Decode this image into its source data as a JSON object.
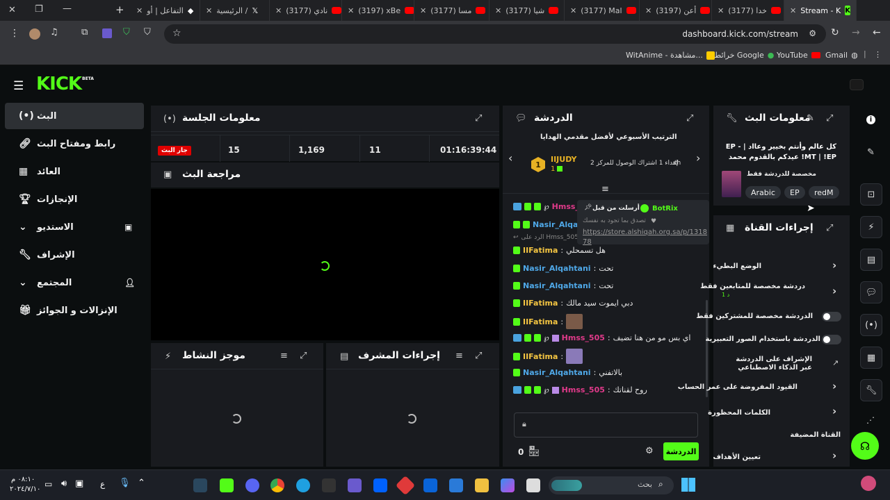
{
  "browser": {
    "tabs": [
      {
        "label": "التفاعل | أو"
      },
      {
        "label": "الرئيسية /"
      },
      {
        "label": "(3177) نادي"
      },
      {
        "label": "(3197) xBe"
      },
      {
        "label": "(3177) مسا"
      },
      {
        "label": "(3177) شيا"
      },
      {
        "label": "(3177) Mal"
      },
      {
        "label": "(3197) أعن"
      },
      {
        "label": "(3177) خدا"
      },
      {
        "label": "Stream - K"
      }
    ],
    "new_tab_label": "+",
    "url": "dashboard.kick.com/stream",
    "bookmarks": [
      "WitAnime - مشاهدة...",
      "خرائط Google",
      "YouTube",
      "Gmail"
    ]
  },
  "app": {
    "logo": "KICK",
    "logo_sup": "BETA",
    "nav": [
      {
        "label": "البث",
        "icon": "broadcast-icon"
      },
      {
        "label": "رابط ومفتاح البث",
        "icon": "link-icon"
      },
      {
        "label": "العائد",
        "icon": "chart-icon"
      },
      {
        "label": "الإنجازات",
        "icon": "trophy-icon"
      },
      {
        "label": "الاستديو",
        "icon": "studio-icon"
      },
      {
        "label": "الإشراف",
        "icon": "wrench-icon"
      },
      {
        "label": "المجتمع",
        "icon": "community-icon"
      },
      {
        "label": "الإنزالات و الجوائز",
        "icon": "gift-icon"
      }
    ],
    "session": {
      "title": "معلومات الجلسة",
      "live_badge": "جار البث",
      "stats": [
        "15",
        "1,169",
        "11",
        "01:16:39:44"
      ]
    },
    "preview": {
      "title": "مراجعة البث"
    },
    "activity": {
      "title": "موجز النشاط"
    },
    "modactions": {
      "title": "إجراءات المشرف"
    },
    "chat": {
      "title": "الدردشة",
      "leaderboard_title": "الترتيب الأسبوعي لأفضل مقدمي الهدايا",
      "top_user": "IIJUDY",
      "top_rank": "1",
      "top_count": "1",
      "gift_text": "إهداء 1 اشتراك الوصول للمركز 2",
      "gift_suffix": "th",
      "pinned_by_label": "أرسلت من قبل",
      "pinned_user": "BotRix",
      "pinned_text": "تصدق بما تجود به نفسك",
      "pinned_link": "https://store.alshiqah.org.sa/p/131878",
      "reply_hint": "الرد على Hmss_505",
      "messages": [
        {
          "user": "Hmss_",
          "color": "r",
          "text": ""
        },
        {
          "user": "Nasir_Alqahta",
          "color": "b",
          "text": ""
        },
        {
          "user": "IIFatima",
          "color": "y",
          "text": "هل تسمحلي"
        },
        {
          "user": "Nasir_Alqahtani",
          "color": "b",
          "text": "تحت"
        },
        {
          "user": "Nasir_Alqahtani",
          "color": "b",
          "text": "تحت"
        },
        {
          "user": "IIFatima",
          "color": "y",
          "text": "دبي ايموت سيد مالك"
        },
        {
          "user": "IIFatima",
          "color": "y",
          "text": ""
        },
        {
          "user": "Hmss_505",
          "color": "r",
          "text": "اي بس مو من هنا تضيف"
        },
        {
          "user": "IIFatima",
          "color": "y",
          "text": ""
        },
        {
          "user": "Nasir_Alqahtani",
          "color": "b",
          "text": "بالاتفني"
        },
        {
          "user": "Hmss_505",
          "color": "r",
          "text": "روح لقناتك"
        }
      ],
      "send_label": "الدردشة",
      "viewer_count": "0"
    },
    "streaminfo": {
      "title": "معلومات البث",
      "stream_title": "كل عالم وأنتم بخيير وعااد | EP - !MT | !EP عيدكم بالقدوم محمد",
      "category_note": "مخصصة للدردشة فقط",
      "tags": [
        "Arabic",
        "EP",
        "redM"
      ]
    },
    "channelactions": {
      "title": "إجراءات القناة",
      "rows": [
        {
          "label": "الوضع البطيء",
          "sub": ""
        },
        {
          "label": "دردشة مخصصة للمتابعين فقط",
          "sub": "1 د"
        },
        {
          "label": "الدردشة مخصصة للمشتركين فقط",
          "sub": ""
        },
        {
          "label": "الدردشة باستخدام الصور التعبيرية",
          "sub": ""
        },
        {
          "label": "الإشراف على الدردشة عبر الذكاء الاصطناعي",
          "sub": ""
        },
        {
          "label": "القيود المفروضة على عمر الحساب",
          "sub": ""
        },
        {
          "label": "الكلمات المحظورة",
          "sub": ""
        },
        {
          "label": "القناة المضيفة",
          "sub": ""
        },
        {
          "label": "تعيين الأهداف",
          "sub": ""
        }
      ]
    }
  },
  "taskbar": {
    "search_placeholder": "بحث",
    "time": "٠٨:١٠ م",
    "date": "٢٠٢٤/٧/١٠",
    "lang": "ع"
  },
  "colors": {
    "kick_green": "#53fc18",
    "live_red": "#e00000"
  }
}
